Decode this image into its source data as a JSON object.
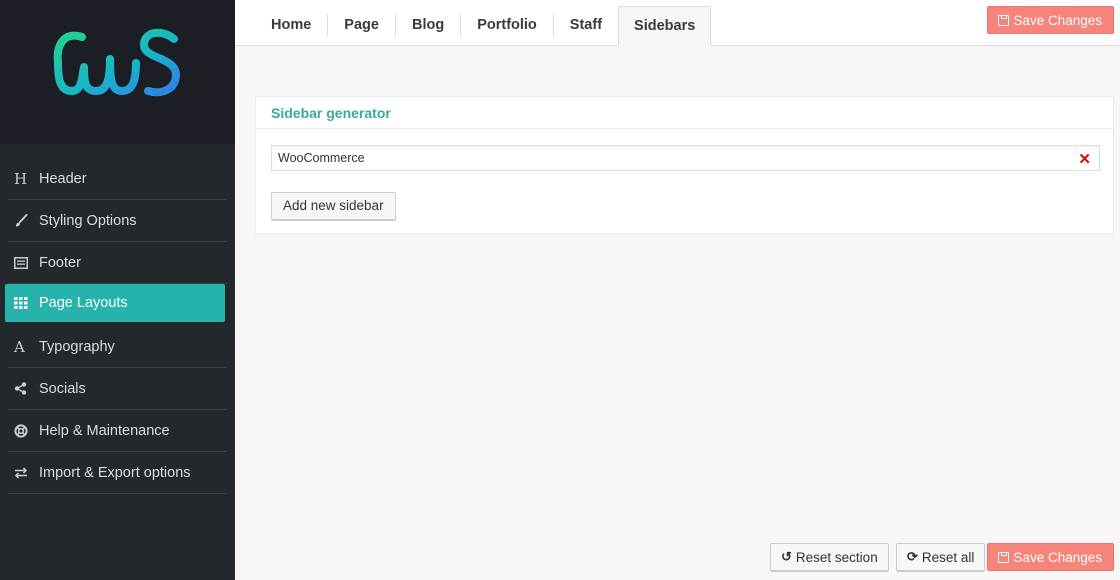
{
  "app": {
    "logo_text": "CwS"
  },
  "colors": {
    "accent": "#26b3ab",
    "save": "#f6847a",
    "sidebar_bg": "#23282d",
    "title": "#3aa9a0"
  },
  "sidebar": {
    "items": [
      {
        "icon": "header-icon",
        "glyph": "H",
        "label": "Header"
      },
      {
        "icon": "brush-icon",
        "glyph": "🖌",
        "label": "Styling Options"
      },
      {
        "icon": "footer-icon",
        "glyph": "▤",
        "label": "Footer"
      },
      {
        "icon": "grid-icon",
        "glyph": "⊞",
        "label": "Page Layouts",
        "active": true
      },
      {
        "icon": "font-icon",
        "glyph": "A",
        "label": "Typography"
      },
      {
        "icon": "share-icon",
        "glyph": "<",
        "label": "Socials"
      },
      {
        "icon": "lifebuoy-icon",
        "glyph": "⊛",
        "label": "Help & Maintenance"
      },
      {
        "icon": "exchange-icon",
        "glyph": "⇄",
        "label": "Import & Export options"
      }
    ]
  },
  "tabs": [
    {
      "label": "Home"
    },
    {
      "label": "Page"
    },
    {
      "label": "Blog"
    },
    {
      "label": "Portfolio"
    },
    {
      "label": "Staff"
    },
    {
      "label": "Sidebars",
      "active": true
    }
  ],
  "toolbar": {
    "save_label": "Save Changes",
    "reset_section_label": "Reset section",
    "reset_all_label": "Reset all"
  },
  "panel": {
    "title": "Sidebar generator",
    "sidebars": [
      {
        "name": "WooCommerce"
      }
    ],
    "add_label": "Add new sidebar",
    "remove_glyph": "✕"
  }
}
